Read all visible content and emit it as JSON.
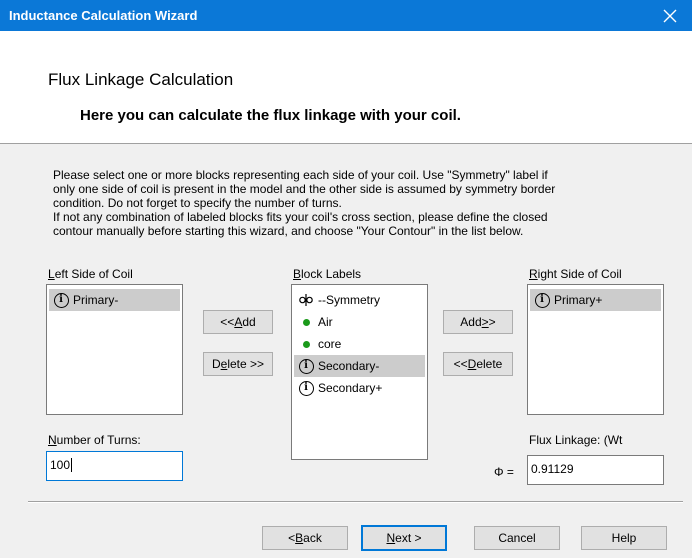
{
  "window": {
    "title": "Inductance Calculation Wizard",
    "close_icon": "close-icon"
  },
  "header": {
    "title": "Flux Linkage Calculation",
    "subtitle": "Here you can calculate the flux linkage with your coil."
  },
  "description": [
    "Please select one or more blocks representing each side of your coil. Use \"Symmetry\" label if",
    "only one side of coil is present in the model and the other side is assumed by symmetry border",
    "condition. Do not forget to specify the number of turns.",
    "If not any combination of labeled blocks fits your coil's cross section, please define the closed",
    "contour manually before starting this wizard, and choose \"Your Contour\" in the list below."
  ],
  "left": {
    "label_u": "L",
    "label_rest": "eft Side of Coil",
    "items": [
      {
        "icon": "info-icon",
        "label": "Primary-",
        "selected": true
      }
    ],
    "turns_label_u": "N",
    "turns_label_rest": "umber of Turns:",
    "turns_value": "100"
  },
  "middle": {
    "label_u": "B",
    "label_rest": "lock Labels",
    "items": [
      {
        "icon": "symmetry-icon",
        "label": "--Symmetry",
        "selected": false
      },
      {
        "icon": "green-dot-icon",
        "label": "Air",
        "selected": false
      },
      {
        "icon": "green-dot-icon",
        "label": "core",
        "selected": false
      },
      {
        "icon": "info-icon",
        "label": "Secondary-",
        "selected": true
      },
      {
        "icon": "info-icon",
        "label": "Secondary+",
        "selected": false
      }
    ]
  },
  "right": {
    "label_u": "R",
    "label_rest": "ight Side of Coil",
    "items": [
      {
        "icon": "info-icon",
        "label": "Primary+",
        "selected": true
      }
    ],
    "flux_label": "Flux Linkage:  (Wt",
    "phi_symbol": "Φ =",
    "flux_value": "0.91129"
  },
  "buttons": {
    "add_left_pre": "<< ",
    "add_left_u": "A",
    "add_left_post": "dd",
    "delete_right_pre": "D",
    "delete_right_u": "e",
    "delete_right_post": "lete >>",
    "add_right_pre": "Add ",
    "add_right_u": ">",
    "add_right_post": ">",
    "delete_left_pre": "<< ",
    "delete_left_u": "D",
    "delete_left_post": "elete",
    "back_pre": "< ",
    "back_u": "B",
    "back_post": "ack",
    "next_u": "N",
    "next_post": "ext >",
    "cancel": "Cancel",
    "help": "Help"
  },
  "colors": {
    "titlebar": "#0b78d7",
    "selection": "#cccccc",
    "green_dot": "#1a9a1a",
    "focus": "#0078d7"
  }
}
